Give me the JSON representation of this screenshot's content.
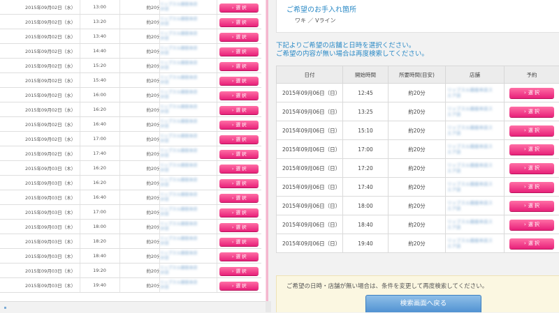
{
  "left_list": {
    "button_label": "選 択",
    "store_blur_text": "リップス&#8226;ル銀座本店",
    "rows": [
      {
        "date": "2015年09月02日（水）",
        "time": "13:00",
        "duration": "約20分"
      },
      {
        "date": "2015年09月02日（水）",
        "time": "13:20",
        "duration": "約20分"
      },
      {
        "date": "2015年09月02日（水）",
        "time": "13:40",
        "duration": "約20分"
      },
      {
        "date": "2015年09月02日（水）",
        "time": "14:40",
        "duration": "約20分"
      },
      {
        "date": "2015年09月02日（水）",
        "time": "15:20",
        "duration": "約20分"
      },
      {
        "date": "2015年09月02日（水）",
        "time": "15:40",
        "duration": "約20分"
      },
      {
        "date": "2015年09月02日（水）",
        "time": "16:00",
        "duration": "約20分"
      },
      {
        "date": "2015年09月02日（水）",
        "time": "16:20",
        "duration": "約20分"
      },
      {
        "date": "2015年09月02日（水）",
        "time": "16:40",
        "duration": "約20分"
      },
      {
        "date": "2015年09月02日（水）",
        "time": "17:00",
        "duration": "約20分"
      },
      {
        "date": "2015年09月02日（水）",
        "time": "17:40",
        "duration": "約20分"
      },
      {
        "date": "2015年09月03日（木）",
        "time": "16:20",
        "duration": "約20分"
      },
      {
        "date": "2015年09月03日（木）",
        "time": "16:20",
        "duration": "約20分"
      },
      {
        "date": "2015年09月03日（木）",
        "time": "16:40",
        "duration": "約20分"
      },
      {
        "date": "2015年09月03日（木）",
        "time": "17:00",
        "duration": "約20分"
      },
      {
        "date": "2015年09月03日（木）",
        "time": "18:00",
        "duration": "約20分"
      },
      {
        "date": "2015年09月03日（木）",
        "time": "18:20",
        "duration": "約20分"
      },
      {
        "date": "2015年09月03日（木）",
        "time": "18:40",
        "duration": "約20分"
      },
      {
        "date": "2015年09月03日（木）",
        "time": "19:20",
        "duration": "約20分"
      },
      {
        "date": "2015年09月03日（木）",
        "time": "19:40",
        "duration": "約20分"
      }
    ]
  },
  "care_area": {
    "title": "ご希望のお手入れ箇所",
    "value": "ワキ ／ Vライン"
  },
  "instruction": {
    "line1": "下記よりご希望の店舗と日時を選択ください。",
    "line2": "ご希望の内容が無い場合は再度検索してください。"
  },
  "schedule_table": {
    "headers": [
      "日付",
      "開始時間",
      "所要時間(目安)",
      "店舗",
      "予約"
    ],
    "button_label": "選 択",
    "rows": [
      {
        "date": "2015年09月06日（日）",
        "time": "12:45",
        "duration": "約20分"
      },
      {
        "date": "2015年09月06日（日）",
        "time": "13:25",
        "duration": "約20分"
      },
      {
        "date": "2015年09月06日（日）",
        "time": "15:10",
        "duration": "約20分"
      },
      {
        "date": "2015年09月06日（日）",
        "time": "17:00",
        "duration": "約20分"
      },
      {
        "date": "2015年09月06日（日）",
        "time": "17:20",
        "duration": "約20分"
      },
      {
        "date": "2015年09月06日（日）",
        "time": "17:40",
        "duration": "約20分"
      },
      {
        "date": "2015年09月06日（日）",
        "time": "18:00",
        "duration": "約20分"
      },
      {
        "date": "2015年09月06日（日）",
        "time": "18:40",
        "duration": "約20分"
      },
      {
        "date": "2015年09月06日（日）",
        "time": "19:40",
        "duration": "約20分"
      }
    ]
  },
  "notice": {
    "text": "ご希望の日時・店舗が無い場合は、条件を変更して再度検索してください。",
    "back_button_label": "検索画面へ戻る"
  },
  "colors": {
    "accent_blue": "#2b8ac6",
    "button_pink": "#e8217a",
    "notice_bg": "#fbf7e1"
  }
}
